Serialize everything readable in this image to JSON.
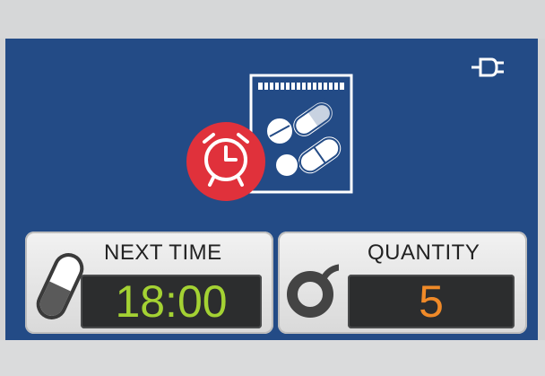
{
  "status": {
    "power_icon": "plug-icon"
  },
  "hero": {
    "icon": "alarm-clock-icon",
    "secondary_icon": "pill-pack-icon"
  },
  "next_time": {
    "label": "NEXT TIME",
    "value": "18:00",
    "icon": "capsule-icon"
  },
  "quantity": {
    "label": "QUANTITY",
    "value": "5",
    "icon": "dial-icon"
  },
  "colors": {
    "panel": "#234b86",
    "alarm_red": "#e0313b",
    "time_green": "#a4d233",
    "quantity_orange": "#f08a28"
  }
}
